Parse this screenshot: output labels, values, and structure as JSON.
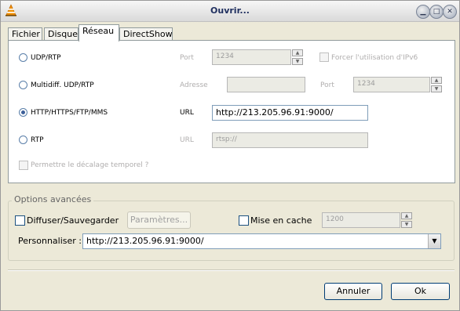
{
  "window": {
    "title": "Ouvrir..."
  },
  "tabs": [
    {
      "label": "Fichier"
    },
    {
      "label": "Disque"
    },
    {
      "label": "Réseau"
    },
    {
      "label": "DirectShow"
    }
  ],
  "network": {
    "udp": {
      "label": "UDP/RTP",
      "port_label": "Port",
      "port_value": "1234",
      "ipv6_label": "Forcer l'utilisation d'IPv6"
    },
    "multicast": {
      "label": "Multidiff. UDP/RTP",
      "address_label": "Adresse",
      "address_value": "",
      "port_label": "Port",
      "port_value": "1234"
    },
    "http": {
      "label": "HTTP/HTTPS/FTP/MMS",
      "url_label": "URL",
      "url_value": "http://213.205.96.91:9000/"
    },
    "rtp": {
      "label": "RTP",
      "url_label": "URL",
      "url_value": "rtsp://"
    },
    "timeshift_label": "Permettre le décalage temporel ?"
  },
  "advanced": {
    "title": "Options avancées",
    "stream_label": "Diffuser/Sauvegarder",
    "settings_button": "Paramètres...",
    "cache_label": "Mise en cache",
    "cache_value": "1200",
    "customize_label": "Personnaliser :",
    "customize_value": "http://213.205.96.91:9000/"
  },
  "buttons": {
    "cancel": "Annuler",
    "ok": "Ok"
  },
  "colors": {
    "window_bg": "#ece9d8",
    "title_text": "#1f2f5f",
    "field_border": "#7f9db9"
  }
}
